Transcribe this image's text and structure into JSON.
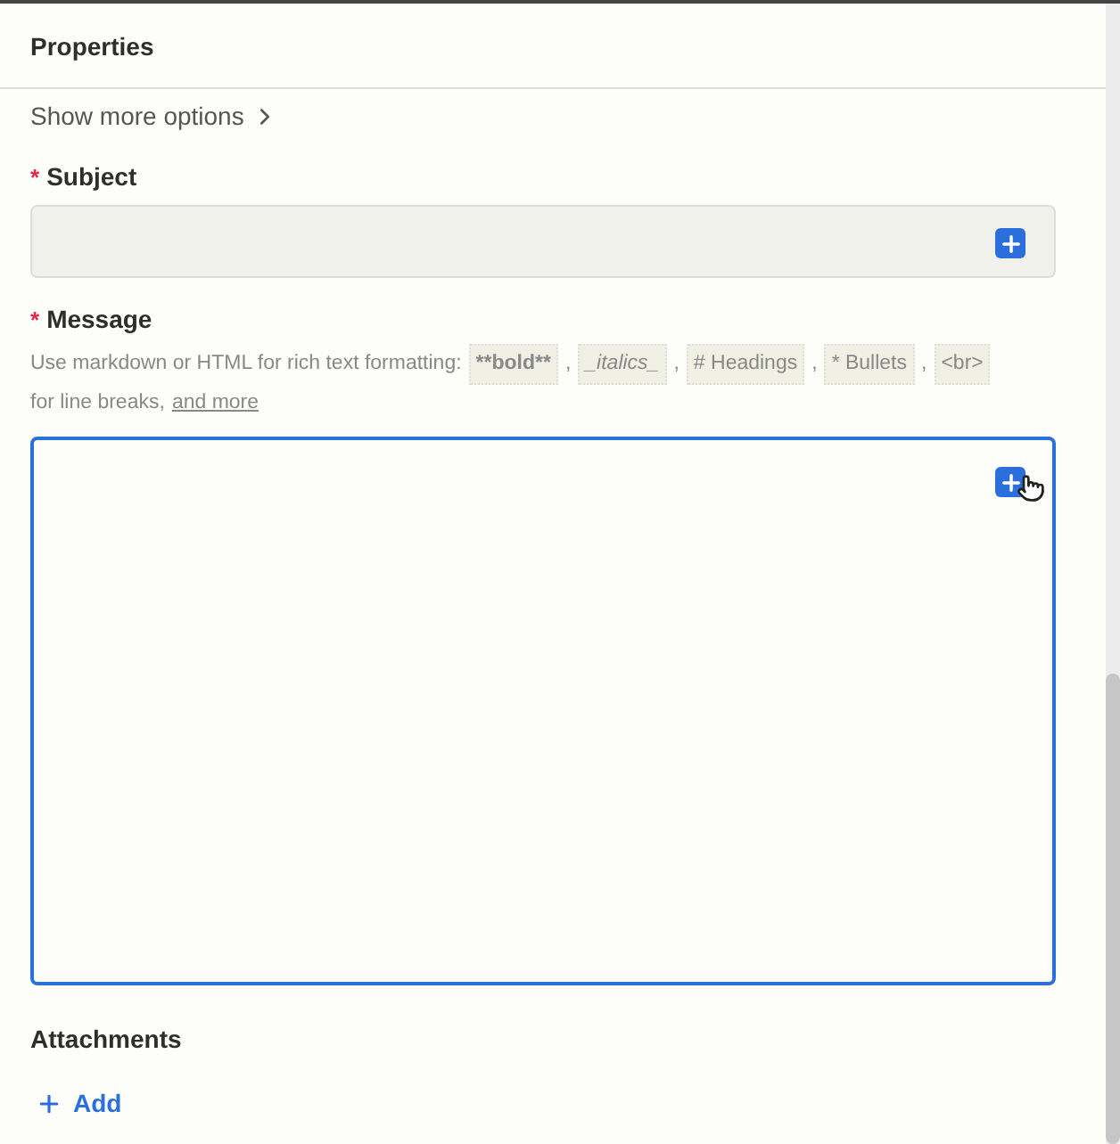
{
  "panel": {
    "title": "Properties"
  },
  "more_options": {
    "label": "Show more options",
    "expanded": false
  },
  "fields": [
    {
      "kind": "input",
      "label": "Subject",
      "required": true,
      "required_marker": "*",
      "focused": false,
      "filled_bg": true
    },
    {
      "kind": "textarea",
      "label": "Message",
      "required": true,
      "required_marker": "*",
      "focused": true,
      "filled_bg": false,
      "hint": {
        "before": "Use markdown or HTML for rich text formatting:",
        "codes": [
          {
            "text": "**bold**",
            "kind": "bold"
          },
          {
            "text": "_italics_",
            "kind": "italic"
          },
          {
            "text": "# Headings",
            "kind": "plain"
          },
          {
            "text": "* Bullets",
            "kind": "plain"
          },
          {
            "text": "<br>",
            "kind": "plain"
          }
        ],
        "separator": ",",
        "after": "for line breaks,",
        "link": "and more"
      }
    }
  ],
  "attachments": {
    "label": "Attachments",
    "add": "Add"
  }
}
